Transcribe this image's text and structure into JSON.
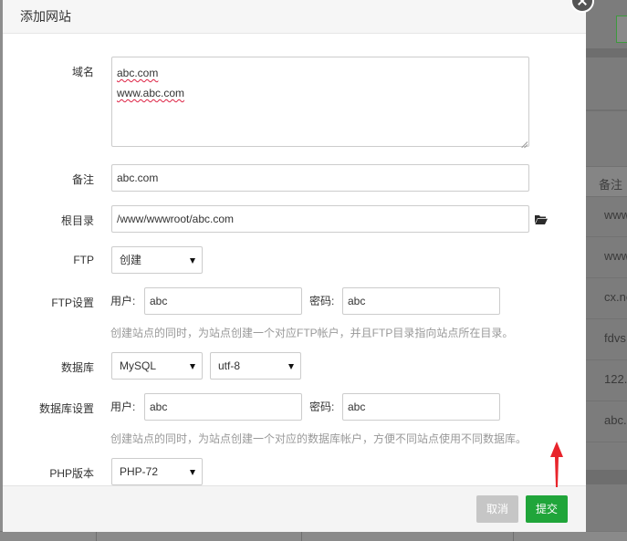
{
  "background": {
    "table_header": "备注",
    "rows": [
      "www",
      "www",
      "cx.no",
      "fdvs",
      "122.",
      "abc."
    ]
  },
  "dialog": {
    "title": "添加网站",
    "domain": {
      "label": "域名",
      "lines": [
        "abc.com",
        "www.abc.com"
      ]
    },
    "remark": {
      "label": "备注",
      "value": "abc.com"
    },
    "root_dir": {
      "label": "根目录",
      "value": "/www/wwwroot/abc.com",
      "icon": "folder-open-icon"
    },
    "ftp": {
      "label": "FTP",
      "selected": "创建"
    },
    "ftp_settings": {
      "label": "FTP设置",
      "user_label": "用户:",
      "user_value": "abc",
      "password_label": "密码:",
      "password_value": "abc",
      "hint": "创建站点的同时，为站点创建一个对应FTP帐户，并且FTP目录指向站点所在目录。"
    },
    "database": {
      "label": "数据库",
      "type_selected": "MySQL",
      "charset_selected": "utf-8"
    },
    "database_settings": {
      "label": "数据库设置",
      "user_label": "用户:",
      "user_value": "abc",
      "password_label": "密码:",
      "password_value": "abc",
      "hint": "创建站点的同时，为站点创建一个对应的数据库帐户，方便不同站点使用不同数据库。"
    },
    "php": {
      "label": "PHP版本",
      "selected": "PHP-72"
    },
    "buttons": {
      "cancel": "取消",
      "submit": "提交"
    }
  },
  "colors": {
    "submit_button": "#20a53a",
    "cancel_button": "#c6c6c6",
    "annotation_arrow": "#e8242b"
  }
}
